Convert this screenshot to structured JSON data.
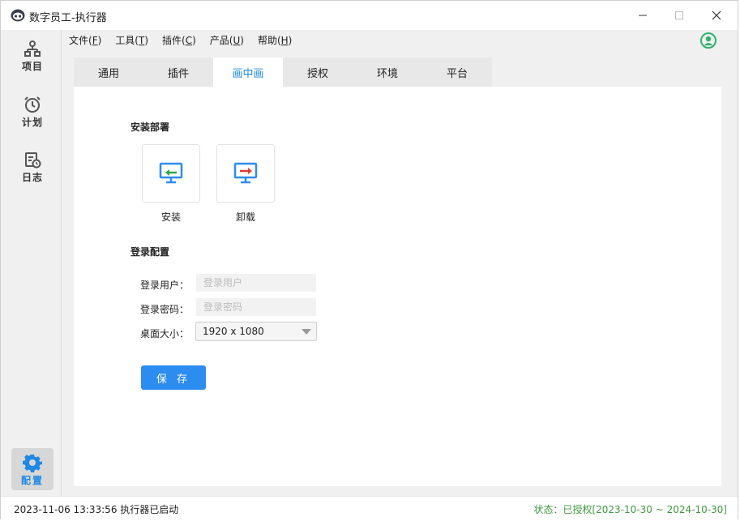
{
  "window": {
    "title": "数字员工-执行器"
  },
  "sidebar": {
    "items": [
      {
        "label": "项目",
        "icon": "sitemap-icon"
      },
      {
        "label": "计划",
        "icon": "alarm-clock-icon"
      },
      {
        "label": "日志",
        "icon": "log-calendar-icon"
      }
    ],
    "active": {
      "label": "配置",
      "icon": "gear-icon"
    }
  },
  "menubar": {
    "items": [
      {
        "text": "文件(",
        "key": "F",
        "end": ")"
      },
      {
        "text": "工具(",
        "key": "T",
        "end": ")"
      },
      {
        "text": "插件(",
        "key": "C",
        "end": ")"
      },
      {
        "text": "产品(",
        "key": "U",
        "end": ")"
      },
      {
        "text": "帮助(",
        "key": "H",
        "end": ")"
      }
    ]
  },
  "tabs": [
    {
      "label": "通用"
    },
    {
      "label": "插件"
    },
    {
      "label": "画中画"
    },
    {
      "label": "授权"
    },
    {
      "label": "环境"
    },
    {
      "label": "平台"
    }
  ],
  "active_tab": "画中画",
  "install_section": {
    "title": "安装部署",
    "install_label": "安装",
    "uninstall_label": "卸载"
  },
  "login_section": {
    "title": "登录配置",
    "user_label": "登录用户：",
    "user_placeholder": "登录用户",
    "password_label": "登录密码：",
    "password_placeholder": "登录密码",
    "desktop_label": "桌面大小：",
    "desktop_value": "1920 x 1080"
  },
  "save_label": "保 存",
  "statusbar": {
    "left": "2023-11-06 13:33:56 执行器已启动",
    "right": "状态：已授权[2023-10-30 ~ 2024-10-30]"
  },
  "colors": {
    "accent": "#1e88e5",
    "button": "#2d8cf0",
    "status_ok": "#3d9a3d",
    "user_icon": "#2fb36b"
  }
}
